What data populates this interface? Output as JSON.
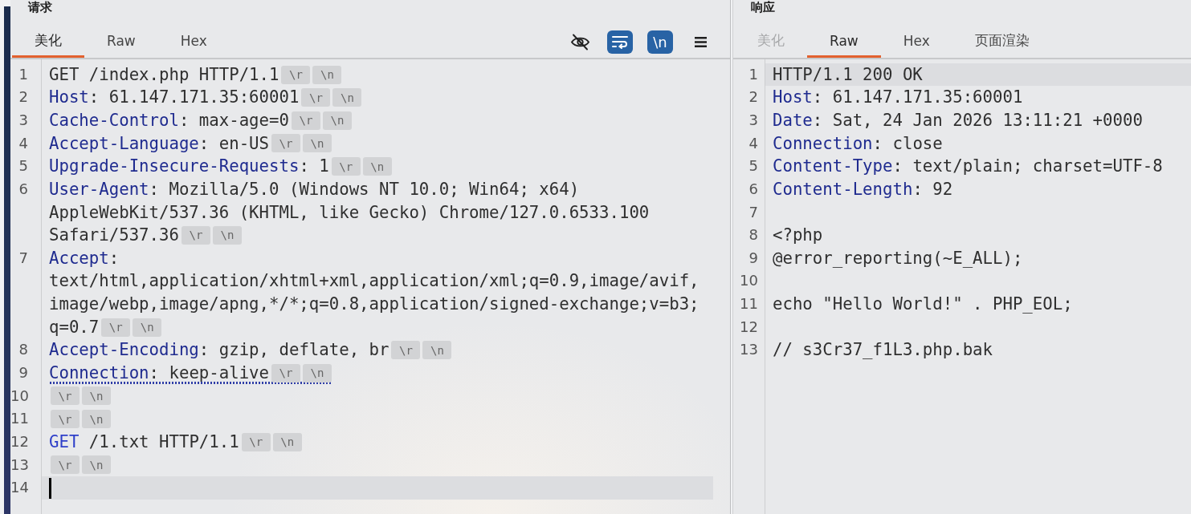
{
  "request": {
    "title": "请求",
    "focused": true,
    "tabs": [
      {
        "label": "美化",
        "selected": true,
        "disabled": false
      },
      {
        "label": "Raw",
        "selected": false,
        "disabled": false
      },
      {
        "label": "Hex",
        "selected": false,
        "disabled": false
      }
    ],
    "toolbar": [
      {
        "kind": "hide",
        "on": false
      },
      {
        "kind": "wrap",
        "on": true
      },
      {
        "kind": "newline",
        "label": "\\n",
        "on": true
      },
      {
        "kind": "menu"
      }
    ],
    "lines": [
      {
        "number": "1",
        "tokens": [
          {
            "kind": "plain",
            "text": "GET /index.php HTTP/1.1"
          }
        ],
        "endings": [
          "\\r",
          "\\n"
        ],
        "current": false,
        "marked": false
      },
      {
        "number": "2",
        "tokens": [
          {
            "kind": "key",
            "text": "Host"
          },
          {
            "kind": "plain",
            "text": ": 61.147.171.35:60001"
          }
        ],
        "endings": [
          "\\r",
          "\\n"
        ],
        "current": false,
        "marked": false
      },
      {
        "number": "3",
        "tokens": [
          {
            "kind": "key",
            "text": "Cache-Control"
          },
          {
            "kind": "plain",
            "text": ": max-age=0"
          }
        ],
        "endings": [
          "\\r",
          "\\n"
        ],
        "current": false,
        "marked": false
      },
      {
        "number": "4",
        "tokens": [
          {
            "kind": "key",
            "text": "Accept-Language"
          },
          {
            "kind": "plain",
            "text": ": en-US"
          }
        ],
        "endings": [
          "\\r",
          "\\n"
        ],
        "current": false,
        "marked": false
      },
      {
        "number": "5",
        "tokens": [
          {
            "kind": "key",
            "text": "Upgrade-Insecure-Requests"
          },
          {
            "kind": "plain",
            "text": ": 1"
          }
        ],
        "endings": [
          "\\r",
          "\\n"
        ],
        "current": false,
        "marked": false
      },
      {
        "number": "6",
        "tokens": [
          {
            "kind": "key",
            "text": "User-Agent"
          },
          {
            "kind": "plain",
            "text": ": Mozilla/5.0 (Windows NT 10.0; Win64; x64) AppleWebKit/537.36 (KHTML, like Gecko) Chrome/127.0.6533.100 Safari/537.36"
          }
        ],
        "endings": [
          "\\r",
          "\\n"
        ],
        "current": false,
        "marked": false
      },
      {
        "number": "7",
        "tokens": [
          {
            "kind": "key",
            "text": "Accept"
          },
          {
            "kind": "plain",
            "text": ": text/html,application/xhtml+xml,application/xml;q=0.9,image/avif,image/webp,image/apng,*/*;q=0.8,application/signed-exchange;v=b3;q=0.7"
          }
        ],
        "endings": [
          "\\r",
          "\\n"
        ],
        "current": false,
        "marked": false
      },
      {
        "number": "8",
        "tokens": [
          {
            "kind": "key",
            "text": "Accept-Encoding"
          },
          {
            "kind": "plain",
            "text": ": gzip, deflate, br"
          }
        ],
        "endings": [
          "\\r",
          "\\n"
        ],
        "current": false,
        "marked": false
      },
      {
        "number": "9",
        "tokens": [
          {
            "kind": "key",
            "text": "Connection"
          },
          {
            "kind": "plain",
            "text": ": keep-alive"
          }
        ],
        "endings": [
          "\\r",
          "\\n"
        ],
        "current": false,
        "marked": true
      },
      {
        "number": "10",
        "endings": [
          "\\r",
          "\\n"
        ],
        "current": false,
        "marked": false
      },
      {
        "number": "11",
        "endings": [
          "\\r",
          "\\n"
        ],
        "current": false,
        "marked": false
      },
      {
        "number": "12",
        "tokens": [
          {
            "kind": "method",
            "text": "GET"
          },
          {
            "kind": "plain",
            "text": " /1.txt HTTP/1.1"
          }
        ],
        "endings": [
          "\\r",
          "\\n"
        ],
        "current": false,
        "marked": false
      },
      {
        "number": "13",
        "endings": [
          "\\r",
          "\\n"
        ],
        "current": false,
        "marked": false
      },
      {
        "number": "14",
        "current": true,
        "marked": false
      }
    ]
  },
  "response": {
    "title": "响应",
    "focused": false,
    "tabs": [
      {
        "label": "美化",
        "selected": false,
        "disabled": true
      },
      {
        "label": "Raw",
        "selected": true,
        "disabled": false
      },
      {
        "label": "Hex",
        "selected": false,
        "disabled": false
      },
      {
        "label": "页面渲染",
        "selected": false,
        "disabled": false
      }
    ],
    "lines": [
      {
        "number": "1",
        "tokens": [
          {
            "kind": "plain",
            "text": "HTTP/1.1 200 OK"
          }
        ],
        "current": true
      },
      {
        "number": "2",
        "tokens": [
          {
            "kind": "key",
            "text": "Host"
          },
          {
            "kind": "plain",
            "text": ": 61.147.171.35:60001"
          }
        ],
        "current": false
      },
      {
        "number": "3",
        "tokens": [
          {
            "kind": "key",
            "text": "Date"
          },
          {
            "kind": "plain",
            "text": ": Sat, 24 Jan 2026 13:11:21 +0000"
          }
        ],
        "current": false
      },
      {
        "number": "4",
        "tokens": [
          {
            "kind": "key",
            "text": "Connection"
          },
          {
            "kind": "plain",
            "text": ": close"
          }
        ],
        "current": false
      },
      {
        "number": "5",
        "tokens": [
          {
            "kind": "key",
            "text": "Content-Type"
          },
          {
            "kind": "plain",
            "text": ": text/plain; charset=UTF-8"
          }
        ],
        "current": false
      },
      {
        "number": "6",
        "tokens": [
          {
            "kind": "key",
            "text": "Content-Length"
          },
          {
            "kind": "plain",
            "text": ": 92"
          }
        ],
        "current": false
      },
      {
        "number": "7",
        "current": false
      },
      {
        "number": "8",
        "tokens": [
          {
            "kind": "plain",
            "text": "<?php"
          }
        ],
        "current": false
      },
      {
        "number": "9",
        "tokens": [
          {
            "kind": "plain",
            "text": "@error_reporting(~E_ALL);"
          }
        ],
        "current": false
      },
      {
        "number": "10",
        "current": false
      },
      {
        "number": "11",
        "tokens": [
          {
            "kind": "plain",
            "text": "echo \"Hello World!\" . PHP_EOL;"
          }
        ],
        "current": false
      },
      {
        "number": "12",
        "current": false
      },
      {
        "number": "13",
        "tokens": [
          {
            "kind": "plain",
            "text": "// s3Cr37_f1L3.php.bak"
          }
        ],
        "current": false
      }
    ]
  }
}
